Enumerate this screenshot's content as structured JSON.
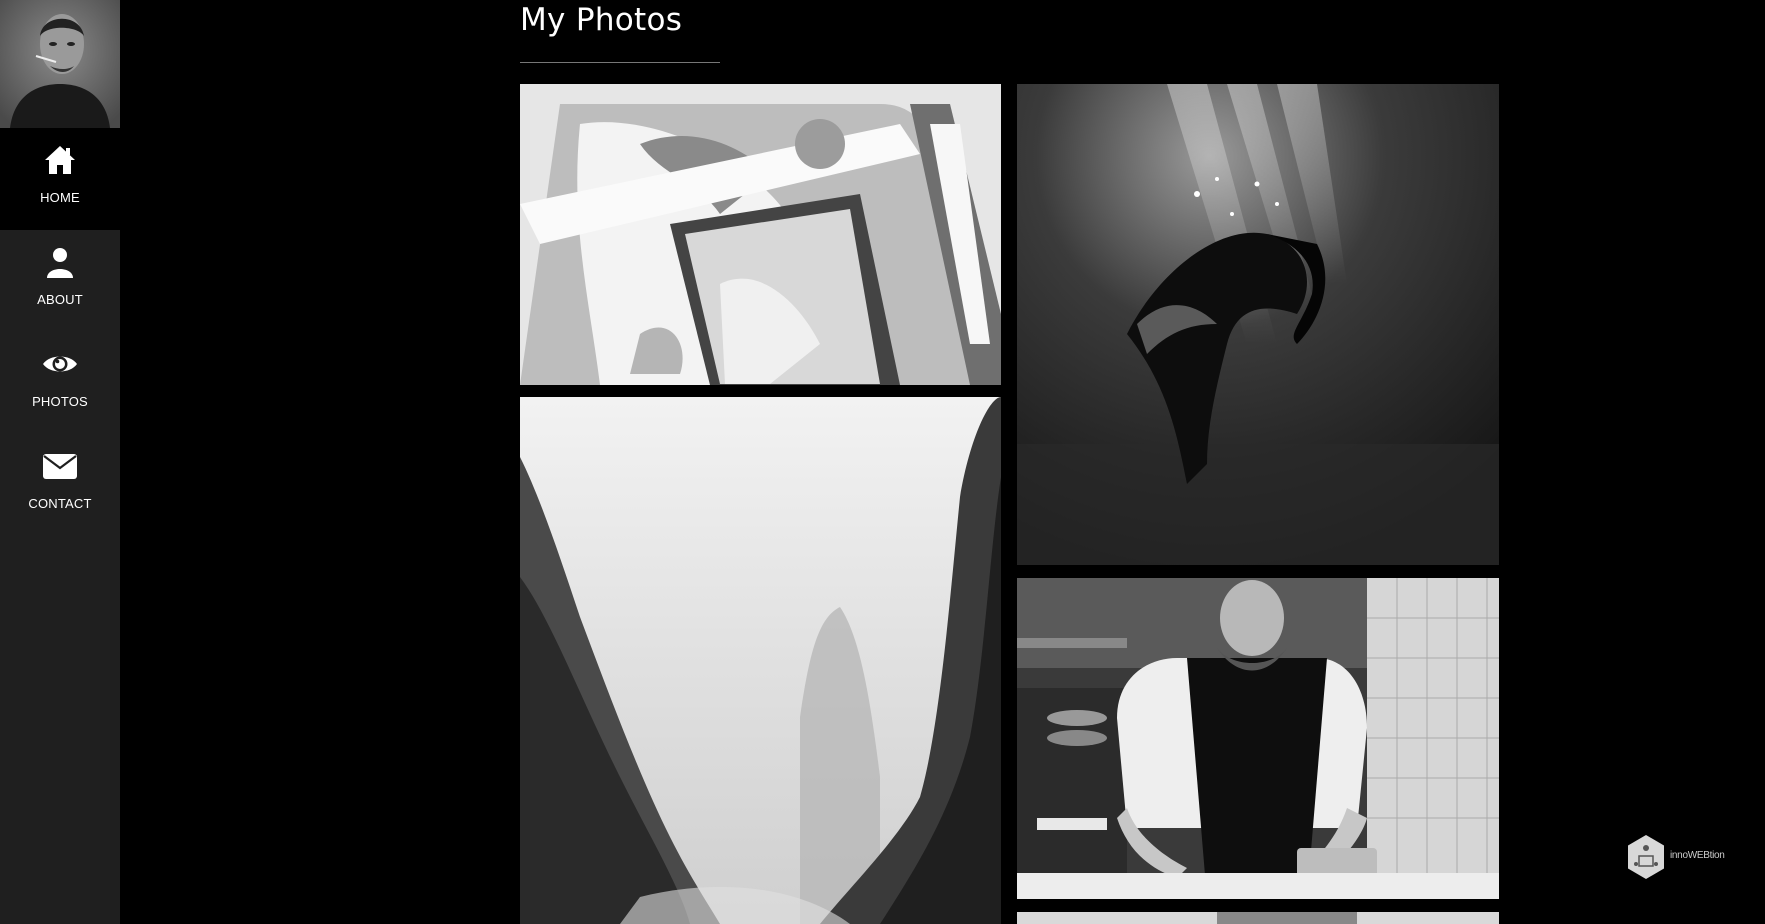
{
  "sidebar": {
    "items": [
      {
        "label": "HOME",
        "icon": "home-icon",
        "active": true
      },
      {
        "label": "ABOUT",
        "icon": "user-icon",
        "active": false
      },
      {
        "label": "PHOTOS",
        "icon": "eye-icon",
        "active": false
      },
      {
        "label": "CONTACT",
        "icon": "envelope-icon",
        "active": false
      }
    ]
  },
  "main": {
    "title": "My Photos",
    "photos": [
      {
        "subject": "wedding couple in car window"
      },
      {
        "subject": "person floating underwater"
      },
      {
        "subject": "misty canyon cliffs"
      },
      {
        "subject": "chef plating food in kitchen"
      },
      {
        "subject": "partial photo"
      }
    ]
  },
  "badge": {
    "text": "innoWEBtion"
  },
  "colors": {
    "background": "#000000",
    "sidebar": "#1f1f1f",
    "text": "#ffffff"
  }
}
